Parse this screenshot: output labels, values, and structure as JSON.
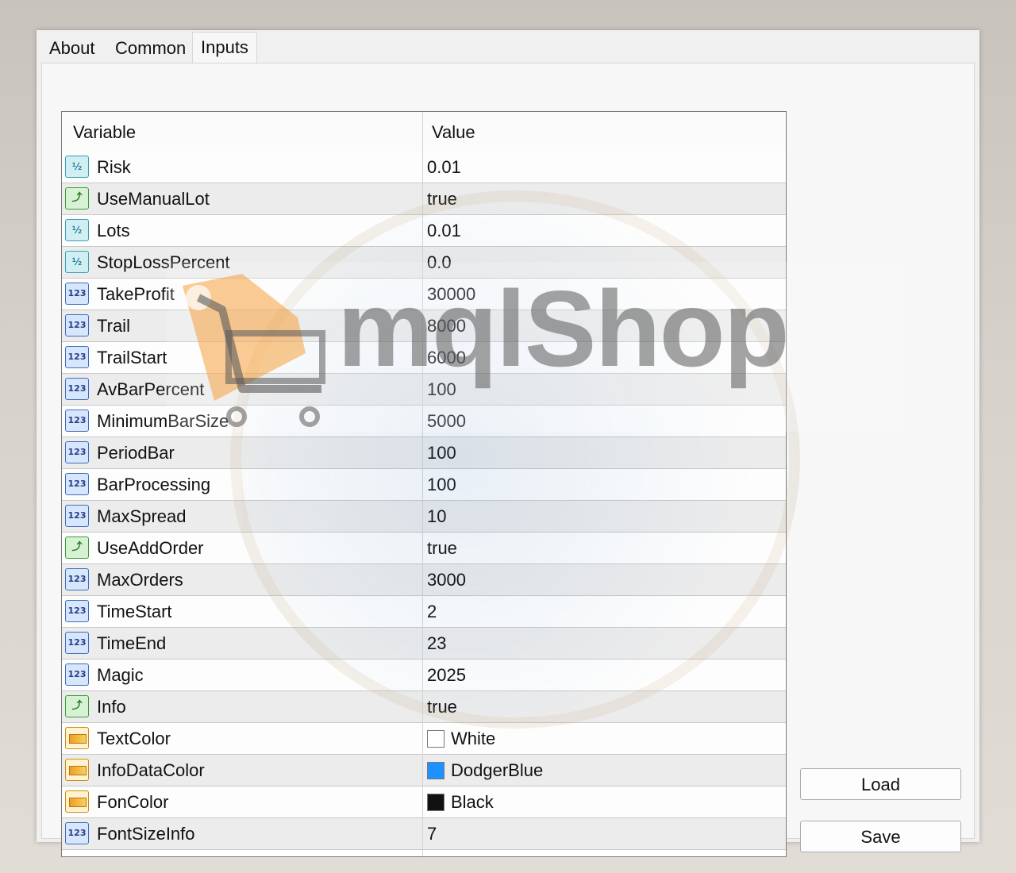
{
  "tabs": [
    "About",
    "Common",
    "Inputs"
  ],
  "active_tab": "Inputs",
  "grid": {
    "header": {
      "variable": "Variable",
      "value": "Value"
    },
    "rows": [
      {
        "icon": "double-type-icon",
        "name": "Risk",
        "value": "0.01"
      },
      {
        "icon": "bool-type-icon",
        "name": "UseManualLot",
        "value": "true"
      },
      {
        "icon": "double-type-icon",
        "name": "Lots",
        "value": "0.01"
      },
      {
        "icon": "double-type-icon",
        "name": "StopLossPercent",
        "value": "0.0"
      },
      {
        "icon": "int-type-icon",
        "name": "TakeProfit",
        "value": "30000"
      },
      {
        "icon": "int-type-icon",
        "name": "Trail",
        "value": "8000"
      },
      {
        "icon": "int-type-icon",
        "name": "TrailStart",
        "value": "6000"
      },
      {
        "icon": "int-type-icon",
        "name": "AvBarPercent",
        "value": "100"
      },
      {
        "icon": "int-type-icon",
        "name": "MinimumBarSize",
        "value": "5000"
      },
      {
        "icon": "int-type-icon",
        "name": "PeriodBar",
        "value": "100"
      },
      {
        "icon": "int-type-icon",
        "name": "BarProcessing",
        "value": "100"
      },
      {
        "icon": "int-type-icon",
        "name": "MaxSpread",
        "value": "10"
      },
      {
        "icon": "bool-type-icon",
        "name": "UseAddOrder",
        "value": "true"
      },
      {
        "icon": "int-type-icon",
        "name": "MaxOrders",
        "value": "3000"
      },
      {
        "icon": "int-type-icon",
        "name": "TimeStart",
        "value": "2"
      },
      {
        "icon": "int-type-icon",
        "name": "TimeEnd",
        "value": "23"
      },
      {
        "icon": "int-type-icon",
        "name": "Magic",
        "value": "2025"
      },
      {
        "icon": "bool-type-icon",
        "name": "Info",
        "value": "true"
      },
      {
        "icon": "color-type-icon",
        "name": "TextColor",
        "value": "White",
        "swatch": "#ffffff"
      },
      {
        "icon": "color-type-icon",
        "name": "InfoDataColor",
        "value": "DodgerBlue",
        "swatch": "#1e90ff"
      },
      {
        "icon": "color-type-icon",
        "name": "FonColor",
        "value": "Black",
        "swatch": "#111111"
      },
      {
        "icon": "int-type-icon",
        "name": "FontSizeInfo",
        "value": "7"
      }
    ]
  },
  "buttons": {
    "load": "Load",
    "save": "Save"
  },
  "watermark": {
    "text": "mqlShop"
  }
}
